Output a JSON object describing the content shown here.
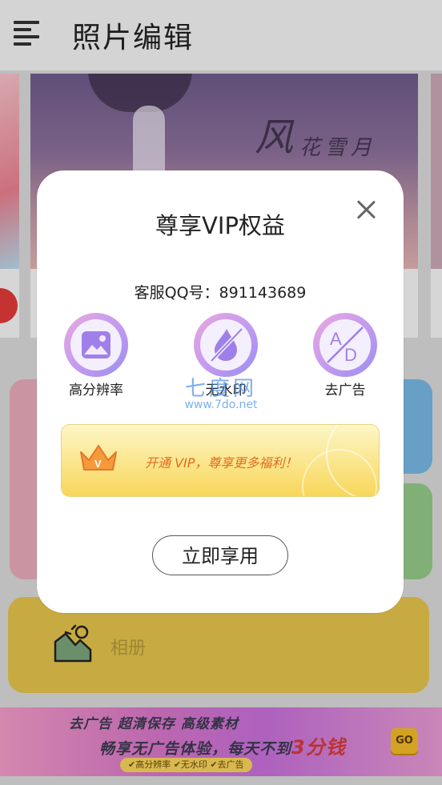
{
  "app_bar": {
    "title": "照片编辑"
  },
  "carousel": {
    "calligraphy_large": "风",
    "calligraphy_small": "花雪月"
  },
  "album_card": {
    "label": "相册"
  },
  "banner": {
    "line1": "去广告 超清保存 高级素材",
    "line2_prefix": "畅享无广告体验，每天不到",
    "line2_highlight": "3分钱",
    "chips": "✔高分辨率 ✔无水印 ✔去广告",
    "go_label": "GO"
  },
  "dialog": {
    "title": "尊享VIP权益",
    "service": "客服QQ号：891143689",
    "benefits": [
      {
        "label": "高分辨率",
        "icon": "image-icon"
      },
      {
        "label": "无水印",
        "icon": "no-watermark-icon"
      },
      {
        "label": "去广告",
        "icon": "no-ads-icon"
      }
    ],
    "watermark_big": "七度网",
    "watermark_small": "www.7do.net",
    "vip_banner_text": "开通 VIP，尊享更多福利！",
    "crown_letter": "V",
    "enjoy_button": "立即享用",
    "icon_ad_letters": [
      "A",
      "D"
    ]
  },
  "colors": {
    "accent_purple": "#a892ef",
    "vip_orange": "#e36b1e",
    "album_yellow": "#e3c24a"
  }
}
